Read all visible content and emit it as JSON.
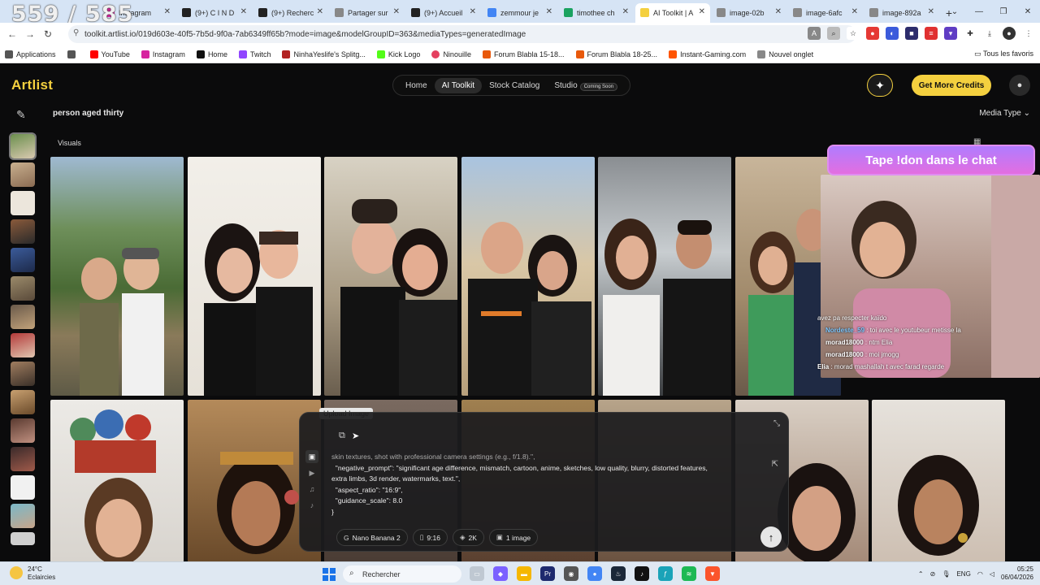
{
  "stream": {
    "counter": "559 / 585",
    "banner": "Tape !don dans le chat",
    "chat": [
      {
        "user": "",
        "msg": "avez pa respecter kaïdo"
      },
      {
        "user": "Nordeste_59",
        "msg": "toi avec le youtubeur metisse la"
      },
      {
        "user": "morad18000",
        "msg": "ntm Elia"
      },
      {
        "user": "morad18000",
        "msg": "moi jmogg"
      },
      {
        "user": "Elia",
        "msg": "morad mashallah t avec farad regarde"
      }
    ]
  },
  "browser": {
    "tabs": [
      {
        "label": "Instagram",
        "color": "#d6249f"
      },
      {
        "label": "(9+) C I N D",
        "color": "#222222"
      },
      {
        "label": "(9+) Recherc",
        "color": "#222222"
      },
      {
        "label": "Partager sur",
        "color": "#888888"
      },
      {
        "label": "(9+) Accueil",
        "color": "#222222"
      },
      {
        "label": "zemmour je",
        "color": "#4285f4"
      },
      {
        "label": "timothee ch",
        "color": "#1aa260"
      },
      {
        "label": "AI Toolkit | A",
        "color": "#111111"
      },
      {
        "label": "image-02b",
        "color": "#888888"
      },
      {
        "label": "image-6afc",
        "color": "#888888"
      },
      {
        "label": "image-892a",
        "color": "#888888"
      }
    ],
    "url": "toolkit.artlist.io/019d603e-40f5-7b5d-9f0a-7ab6349ff65b?mode=image&modelGroupID=363&mediaTypes=generatedImage",
    "bookmarks": [
      {
        "label": "Applications",
        "color": "#555555"
      },
      {
        "label": "",
        "color": "#555555"
      },
      {
        "label": "YouTube",
        "color": "#ff0000"
      },
      {
        "label": "Instagram",
        "color": "#d6249f"
      },
      {
        "label": "Home",
        "color": "#111111"
      },
      {
        "label": "Twitch",
        "color": "#9146ff"
      },
      {
        "label": "NinhaYeslife's Splitg...",
        "color": "#b22222"
      },
      {
        "label": "Kick Logo",
        "color": "#53fc18"
      },
      {
        "label": "Ninouille",
        "color": "#e4405f"
      },
      {
        "label": "Forum Blabla 15-18...",
        "color": "#e8590c"
      },
      {
        "label": "Forum Blabla 18-25...",
        "color": "#e8590c"
      },
      {
        "label": "Instant-Gaming.com",
        "color": "#ff5400"
      },
      {
        "label": "Nouvel onglet",
        "color": "#888888"
      }
    ],
    "bookmarks_right": "Tous les favoris"
  },
  "app": {
    "logo": "Artlist",
    "nav": [
      {
        "label": "Home"
      },
      {
        "label": "AI Toolkit"
      },
      {
        "label": "Stock Catalog"
      },
      {
        "label": "Studio"
      }
    ],
    "studio_badge": "Coming Soon",
    "credits_button": "Get More Credits",
    "query": "person aged thirty",
    "media_type": "Media Type",
    "section": "Visuals",
    "tooltip": "Upload Image",
    "prompt_lines": [
      "skin textures, shot with professional camera settings (e.g., f/1.8).\",",
      "  \"negative_prompt\": \"significant age difference, mismatch, cartoon, anime, sketches, low quality, blurry, distorted features,",
      "extra limbs, 3d render, watermarks, text.\",",
      "  \"aspect_ratio\": \"16:9\",",
      "  \"guidance_scale\": 8.0",
      "}"
    ],
    "chips": [
      {
        "icon": "G",
        "label": "Nano Banana 2"
      },
      {
        "icon": "▯",
        "label": "9:16"
      },
      {
        "icon": "◈",
        "label": "2K"
      },
      {
        "icon": "▣",
        "label": "1 image"
      }
    ]
  },
  "taskbar": {
    "weather_temp": "24°C",
    "weather_desc": "Eclaircies",
    "search": "Rechercher",
    "lang": "ENG",
    "time": "05:25",
    "date": "06/04/2026"
  }
}
